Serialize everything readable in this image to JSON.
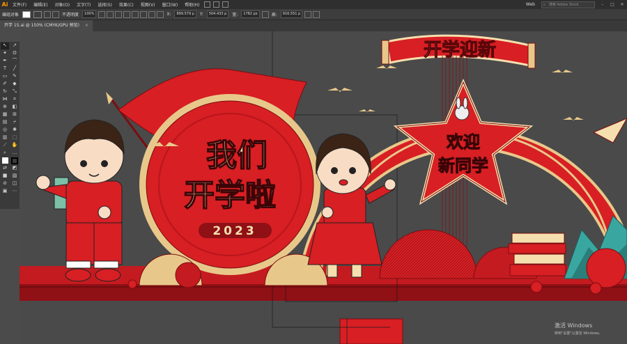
{
  "menubar": {
    "app_icon": "Ai",
    "items": [
      "文件(F)",
      "编辑(E)",
      "对象(O)",
      "文字(T)",
      "选择(S)",
      "效果(C)",
      "视图(V)",
      "窗口(W)",
      "帮助(H)"
    ],
    "workspace": "Web",
    "search_placeholder": "搜索 Adobe Stock"
  },
  "control_bar": {
    "selection_label": "编组对象",
    "opacity_label": "不透明度",
    "opacity_value": "100%",
    "x_label": "X:",
    "x_value": "899.579 p",
    "y_label": "Y:",
    "y_value": "504.433 p",
    "w_label": "宽:",
    "w_value": "1782 px",
    "h_label": "高:",
    "h_value": "916.551 p"
  },
  "document_tab": {
    "title": "开学 15.ai @ 150% (CMYK/GPU 预览)",
    "close": "×"
  },
  "artwork": {
    "headline_line1": "我们",
    "headline_line2": "开学啦",
    "year": "2023",
    "banner": "开学迎新",
    "star_line1": "欢迎",
    "star_line2": "新同学"
  },
  "colors": {
    "red": "#d71f24",
    "dark_red": "#a5141a",
    "gold": "#e8c88a",
    "cream": "#f6dfae",
    "teal": "#3aa6a0"
  },
  "watermark": {
    "line1": "激活 Windows",
    "line2": "转到\"设置\"以激活 Windows。"
  }
}
